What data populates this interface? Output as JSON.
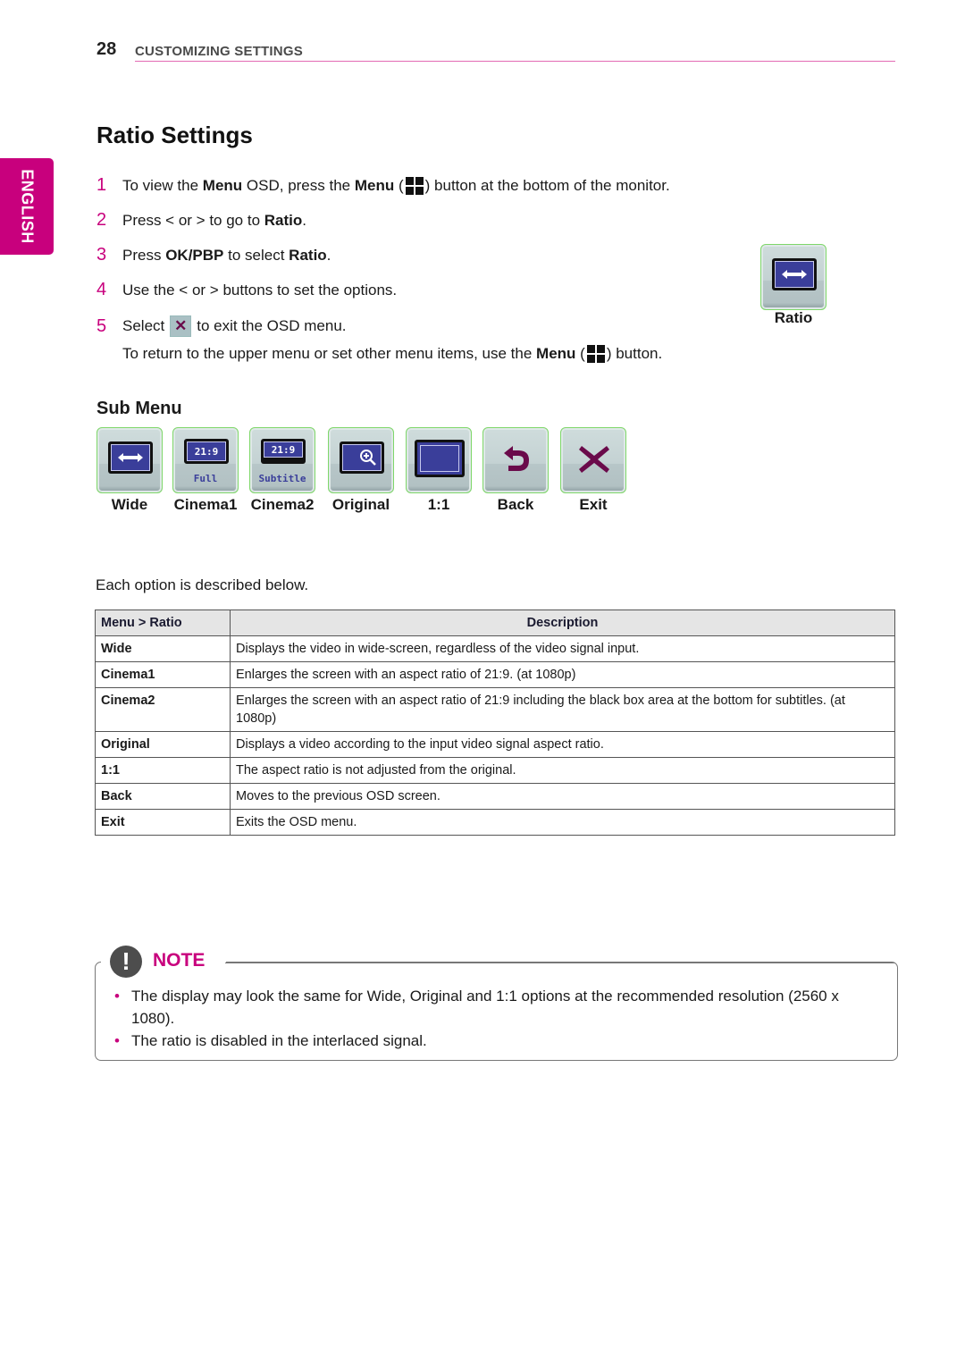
{
  "header": {
    "page_number": "28",
    "section": "CUSTOMIZING SETTINGS"
  },
  "language_tab": "ENGLISH",
  "title": "Ratio Settings",
  "steps": [
    {
      "num": "1",
      "parts": [
        "To view the ",
        "Menu",
        " OSD, press the ",
        "Menu",
        " (",
        ") button at the bottom of the monitor."
      ]
    },
    {
      "num": "2",
      "parts": [
        "Press < or > to go to ",
        "Ratio",
        "."
      ]
    },
    {
      "num": "3",
      "parts": [
        "Press ",
        "OK/PBP",
        " to select ",
        "Ratio",
        "."
      ]
    },
    {
      "num": "4",
      "parts": [
        "Use the < or > buttons to set the options."
      ]
    },
    {
      "num": "5",
      "parts": [
        "Select ",
        "to exit the OSD menu."
      ]
    }
  ],
  "step_note": {
    "parts": [
      "To return to the upper menu or set other menu items, use the ",
      "Menu",
      " (",
      ") button."
    ]
  },
  "icons": {
    "menu": "menu-grid-icon",
    "exit": "exit-x-icon",
    "exit_glyph": "✕"
  },
  "ratio_badge": {
    "label": "Ratio",
    "icon": "wide-arrow-icon"
  },
  "sub_menu": {
    "title": "Sub Menu",
    "items": [
      {
        "label": "Wide",
        "icon": "wide-arrow-icon"
      },
      {
        "label": "Cinema1",
        "icon": "cinema1-icon",
        "screen_text": "21:9",
        "caption": "Full"
      },
      {
        "label": "Cinema2",
        "icon": "cinema2-icon",
        "screen_text": "21:9",
        "caption": "Subtitle"
      },
      {
        "label": "Original",
        "icon": "zoom-in-icon"
      },
      {
        "label": "1:1",
        "icon": "one-to-one-screen-icon"
      },
      {
        "label": "Back",
        "icon": "back-arrow-icon"
      },
      {
        "label": "Exit",
        "icon": "exit-x-icon"
      }
    ]
  },
  "intro": "Each option is described below.",
  "table": {
    "headers": [
      "Menu > Ratio",
      "Description"
    ],
    "rows": [
      [
        "Wide",
        "Displays the video in wide-screen, regardless of the video signal input."
      ],
      [
        "Cinema1",
        "Enlarges the screen with an aspect ratio of 21:9. (at 1080p)"
      ],
      [
        "Cinema2",
        "Enlarges the screen with an aspect ratio of 21:9 including the black box area at the bottom for subtitles. (at 1080p)"
      ],
      [
        "Original",
        "Displays a video according to the input video signal aspect ratio."
      ],
      [
        "1:1",
        "The aspect ratio is not adjusted from the original."
      ],
      [
        "Back",
        "Moves to the previous OSD screen."
      ],
      [
        "Exit",
        "Exits the OSD menu."
      ]
    ]
  },
  "note": {
    "title": "NOTE",
    "icon": "exclamation-icon",
    "bullet": "•",
    "items": [
      "The display may look the same for Wide, Original and 1:1 options at the recommended resolution (2560 x 1080).",
      "The ratio is disabled in the interlaced signal."
    ]
  },
  "colors": {
    "accent": "#c8007d",
    "osd_screen": "#3a3e9a",
    "osd_icon_dark": "#6a0a4a"
  }
}
